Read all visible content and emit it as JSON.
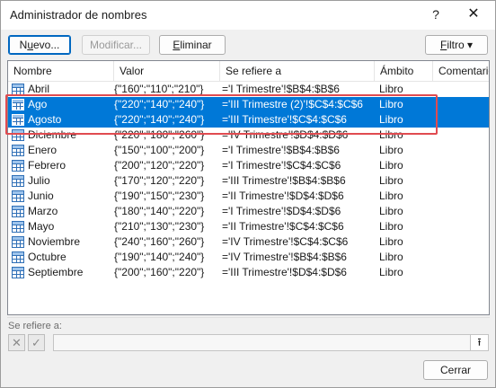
{
  "window": {
    "title": "Administrador de nombres",
    "help_label": "?",
    "close_label": "✕"
  },
  "toolbar": {
    "new_prefix": "N",
    "new_underline": "u",
    "new_suffix": "evo...",
    "edit_label": "Modificar...",
    "delete_underline": "E",
    "delete_suffix": "liminar",
    "filter_underline": "F",
    "filter_suffix": "iltro",
    "filter_arrow": "▾"
  },
  "columns": {
    "name": "Nombre",
    "value": "Valor",
    "refers": "Se refiere a",
    "scope": "Ámbito",
    "comment": "Comentario"
  },
  "rows": [
    {
      "name": "Abril",
      "value": "{\"160\";\"110\";\"210\"}",
      "refers": "='I Trimestre'!$B$4:$B$6",
      "scope": "Libro",
      "selected": false
    },
    {
      "name": "Ago",
      "value": "{\"220\";\"140\";\"240\"}",
      "refers": "='III Trimestre (2)'!$C$4:$C$6",
      "scope": "Libro",
      "selected": true
    },
    {
      "name": "Agosto",
      "value": "{\"220\";\"140\";\"240\"}",
      "refers": "='III Trimestre'!$C$4:$C$6",
      "scope": "Libro",
      "selected": true
    },
    {
      "name": "Diciembre",
      "value": "{\"220\";\"180\";\"260\"}",
      "refers": "='IV Trimestre'!$D$4:$D$6",
      "scope": "Libro",
      "selected": false
    },
    {
      "name": "Enero",
      "value": "{\"150\";\"100\";\"200\"}",
      "refers": "='I Trimestre'!$B$4:$B$6",
      "scope": "Libro",
      "selected": false
    },
    {
      "name": "Febrero",
      "value": "{\"200\";\"120\";\"220\"}",
      "refers": "='I Trimestre'!$C$4:$C$6",
      "scope": "Libro",
      "selected": false
    },
    {
      "name": "Julio",
      "value": "{\"170\";\"120\";\"220\"}",
      "refers": "='III Trimestre'!$B$4:$B$6",
      "scope": "Libro",
      "selected": false
    },
    {
      "name": "Junio",
      "value": "{\"190\";\"150\";\"230\"}",
      "refers": "='II Trimestre'!$D$4:$D$6",
      "scope": "Libro",
      "selected": false
    },
    {
      "name": "Marzo",
      "value": "{\"180\";\"140\";\"220\"}",
      "refers": "='I Trimestre'!$D$4:$D$6",
      "scope": "Libro",
      "selected": false
    },
    {
      "name": "Mayo",
      "value": "{\"210\";\"130\";\"230\"}",
      "refers": "='II Trimestre'!$C$4:$C$6",
      "scope": "Libro",
      "selected": false
    },
    {
      "name": "Noviembre",
      "value": "{\"240\";\"160\";\"260\"}",
      "refers": "='IV Trimestre'!$C$4:$C$6",
      "scope": "Libro",
      "selected": false
    },
    {
      "name": "Octubre",
      "value": "{\"190\";\"140\";\"240\"}",
      "refers": "='IV Trimestre'!$B$4:$B$6",
      "scope": "Libro",
      "selected": false
    },
    {
      "name": "Septiembre",
      "value": "{\"200\";\"160\";\"220\"}",
      "refers": "='III Trimestre'!$D$4:$D$6",
      "scope": "Libro",
      "selected": false
    }
  ],
  "footer": {
    "refers_label": "Se refiere a:",
    "cancel_icon": "✕",
    "confirm_icon": "✓",
    "refers_value": "",
    "collapse_icon": "⭱",
    "close_button": "Cerrar"
  },
  "colors": {
    "selection": "#0078d7",
    "highlight_box": "#e04b50"
  }
}
